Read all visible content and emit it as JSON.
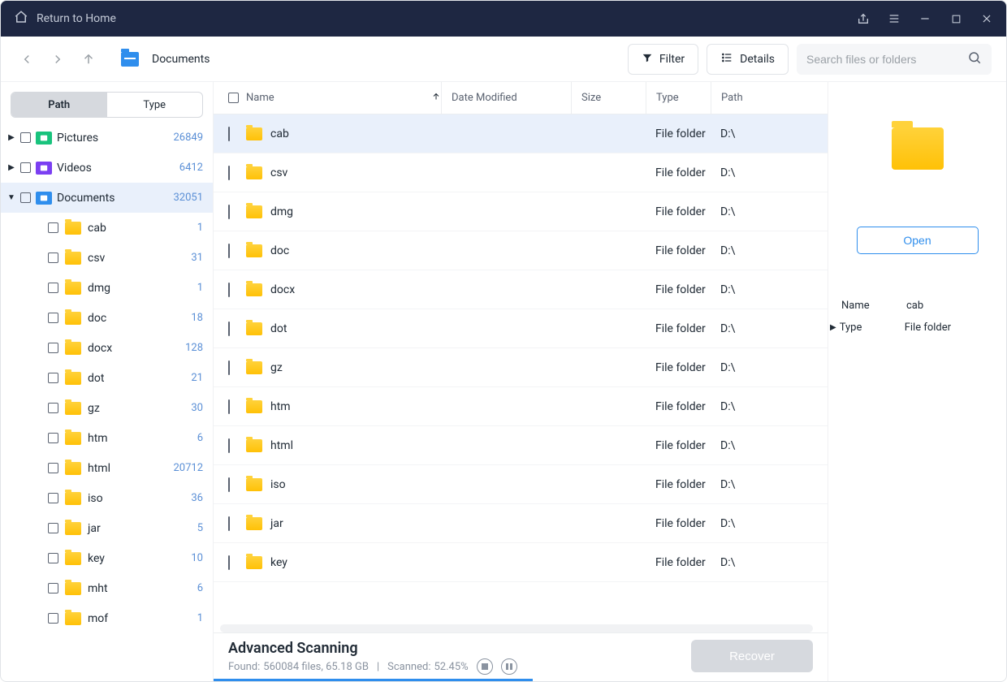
{
  "titlebar": {
    "return_label": "Return to Home"
  },
  "toolbar": {
    "breadcrumb": "Documents",
    "filter_label": "Filter",
    "details_label": "Details",
    "search_placeholder": "Search files or folders"
  },
  "sidebar": {
    "seg_path": "Path",
    "seg_type": "Type",
    "categories": [
      {
        "name": "Pictures",
        "count": "26849",
        "expanded": false,
        "cls": "cat-pictures"
      },
      {
        "name": "Videos",
        "count": "6412",
        "expanded": false,
        "cls": "cat-videos"
      },
      {
        "name": "Documents",
        "count": "32051",
        "expanded": true,
        "cls": "cat-docs",
        "selected": true
      }
    ],
    "children": [
      {
        "name": "cab",
        "count": "1"
      },
      {
        "name": "csv",
        "count": "31"
      },
      {
        "name": "dmg",
        "count": "1"
      },
      {
        "name": "doc",
        "count": "18"
      },
      {
        "name": "docx",
        "count": "128"
      },
      {
        "name": "dot",
        "count": "21"
      },
      {
        "name": "gz",
        "count": "30"
      },
      {
        "name": "htm",
        "count": "6"
      },
      {
        "name": "html",
        "count": "20712"
      },
      {
        "name": "iso",
        "count": "36"
      },
      {
        "name": "jar",
        "count": "5"
      },
      {
        "name": "key",
        "count": "10"
      },
      {
        "name": "mht",
        "count": "6"
      },
      {
        "name": "mof",
        "count": "1"
      }
    ]
  },
  "table": {
    "headers": {
      "name": "Name",
      "date": "Date Modified",
      "size": "Size",
      "type": "Type",
      "path": "Path"
    },
    "rows": [
      {
        "name": "cab",
        "date": "",
        "size": "",
        "type": "File folder",
        "path": "D:\\",
        "selected": true
      },
      {
        "name": "csv",
        "date": "",
        "size": "",
        "type": "File folder",
        "path": "D:\\"
      },
      {
        "name": "dmg",
        "date": "",
        "size": "",
        "type": "File folder",
        "path": "D:\\"
      },
      {
        "name": "doc",
        "date": "",
        "size": "",
        "type": "File folder",
        "path": "D:\\"
      },
      {
        "name": "docx",
        "date": "",
        "size": "",
        "type": "File folder",
        "path": "D:\\"
      },
      {
        "name": "dot",
        "date": "",
        "size": "",
        "type": "File folder",
        "path": "D:\\"
      },
      {
        "name": "gz",
        "date": "",
        "size": "",
        "type": "File folder",
        "path": "D:\\"
      },
      {
        "name": "htm",
        "date": "",
        "size": "",
        "type": "File folder",
        "path": "D:\\"
      },
      {
        "name": "html",
        "date": "",
        "size": "",
        "type": "File folder",
        "path": "D:\\"
      },
      {
        "name": "iso",
        "date": "",
        "size": "",
        "type": "File folder",
        "path": "D:\\"
      },
      {
        "name": "jar",
        "date": "",
        "size": "",
        "type": "File folder",
        "path": "D:\\"
      },
      {
        "name": "key",
        "date": "",
        "size": "",
        "type": "File folder",
        "path": "D:\\"
      }
    ]
  },
  "status": {
    "title": "Advanced Scanning",
    "found_prefix": "Found:",
    "found_value": "560084 files, 65.18 GB",
    "sep": "|",
    "scanned_prefix": "Scanned:",
    "scanned_value": "52.45%",
    "recover_label": "Recover"
  },
  "rightpanel": {
    "open_label": "Open",
    "meta": {
      "name_k": "Name",
      "name_v": "cab",
      "type_k": "Type",
      "type_v": "File folder"
    }
  }
}
